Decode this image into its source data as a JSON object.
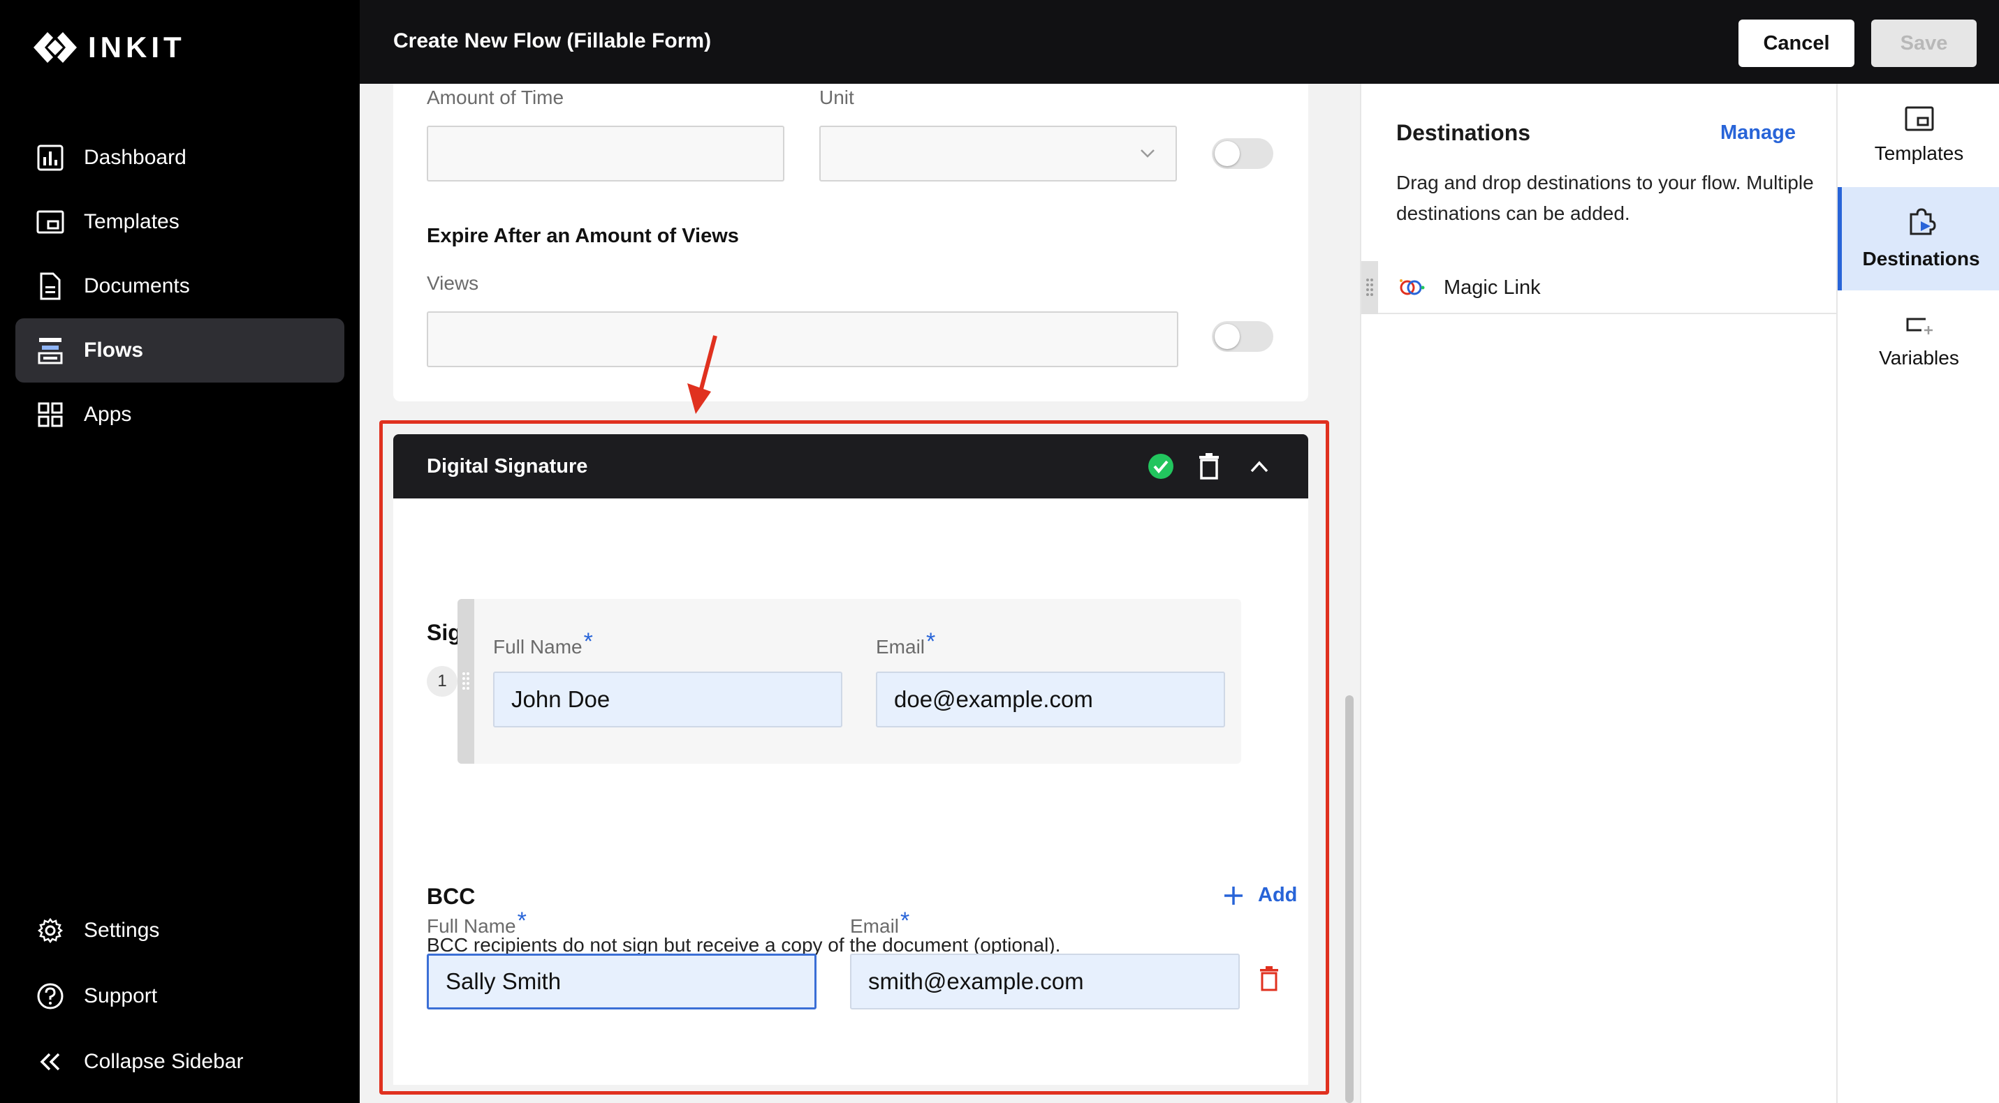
{
  "app": {
    "logo_text": "INKIT"
  },
  "sidebar": {
    "items": [
      {
        "label": "Dashboard",
        "icon": "bar-chart-icon"
      },
      {
        "label": "Templates",
        "icon": "template-icon"
      },
      {
        "label": "Documents",
        "icon": "document-icon"
      },
      {
        "label": "Flows",
        "icon": "flow-icon",
        "active": true
      },
      {
        "label": "Apps",
        "icon": "apps-grid-icon"
      }
    ],
    "bottom_items": [
      {
        "label": "Settings",
        "icon": "gear-icon"
      },
      {
        "label": "Support",
        "icon": "help-circle-icon"
      },
      {
        "label": "Collapse Sidebar",
        "icon": "double-chevron-left-icon"
      }
    ]
  },
  "header": {
    "title": "Create New Flow (Fillable Form)",
    "cancel_label": "Cancel",
    "save_label": "Save"
  },
  "expire_time": {
    "amount_label": "Amount of Time",
    "amount_value": "",
    "unit_label": "Unit",
    "unit_value": "",
    "enabled": false
  },
  "expire_views": {
    "title": "Expire After an Amount of Views",
    "views_label": "Views",
    "views_value": "",
    "enabled": false
  },
  "digital_signature": {
    "title": "Digital Signature",
    "status": "complete",
    "signers_title": "Signers",
    "signers": [
      {
        "index": "1",
        "name_label": "Full Name",
        "name": "John Doe",
        "email_label": "Email",
        "email": "doe@example.com"
      }
    ],
    "bcc_title": "BCC",
    "bcc_add_label": "Add",
    "bcc_description": "BCC recipients do not sign but receive a copy of the document (optional).",
    "bcc": [
      {
        "name_label": "Full Name",
        "name": "Sally Smith",
        "email_label": "Email",
        "email": "smith@example.com"
      }
    ],
    "required_marker": "*"
  },
  "destinations_panel": {
    "title": "Destinations",
    "manage_label": "Manage",
    "description": "Drag and drop destinations to your flow. Multiple destinations can be added.",
    "items": [
      {
        "label": "Magic Link",
        "icon": "magic-link-icon"
      }
    ]
  },
  "right_rail": {
    "items": [
      {
        "label": "Templates",
        "icon": "template-icon"
      },
      {
        "label": "Destinations",
        "icon": "puzzle-icon",
        "active": true
      },
      {
        "label": "Variables",
        "icon": "variable-icon"
      }
    ]
  },
  "colors": {
    "accent": "#2864d8",
    "highlight_frame": "#e0311f",
    "success": "#22c55e",
    "danger": "#e0311f"
  }
}
